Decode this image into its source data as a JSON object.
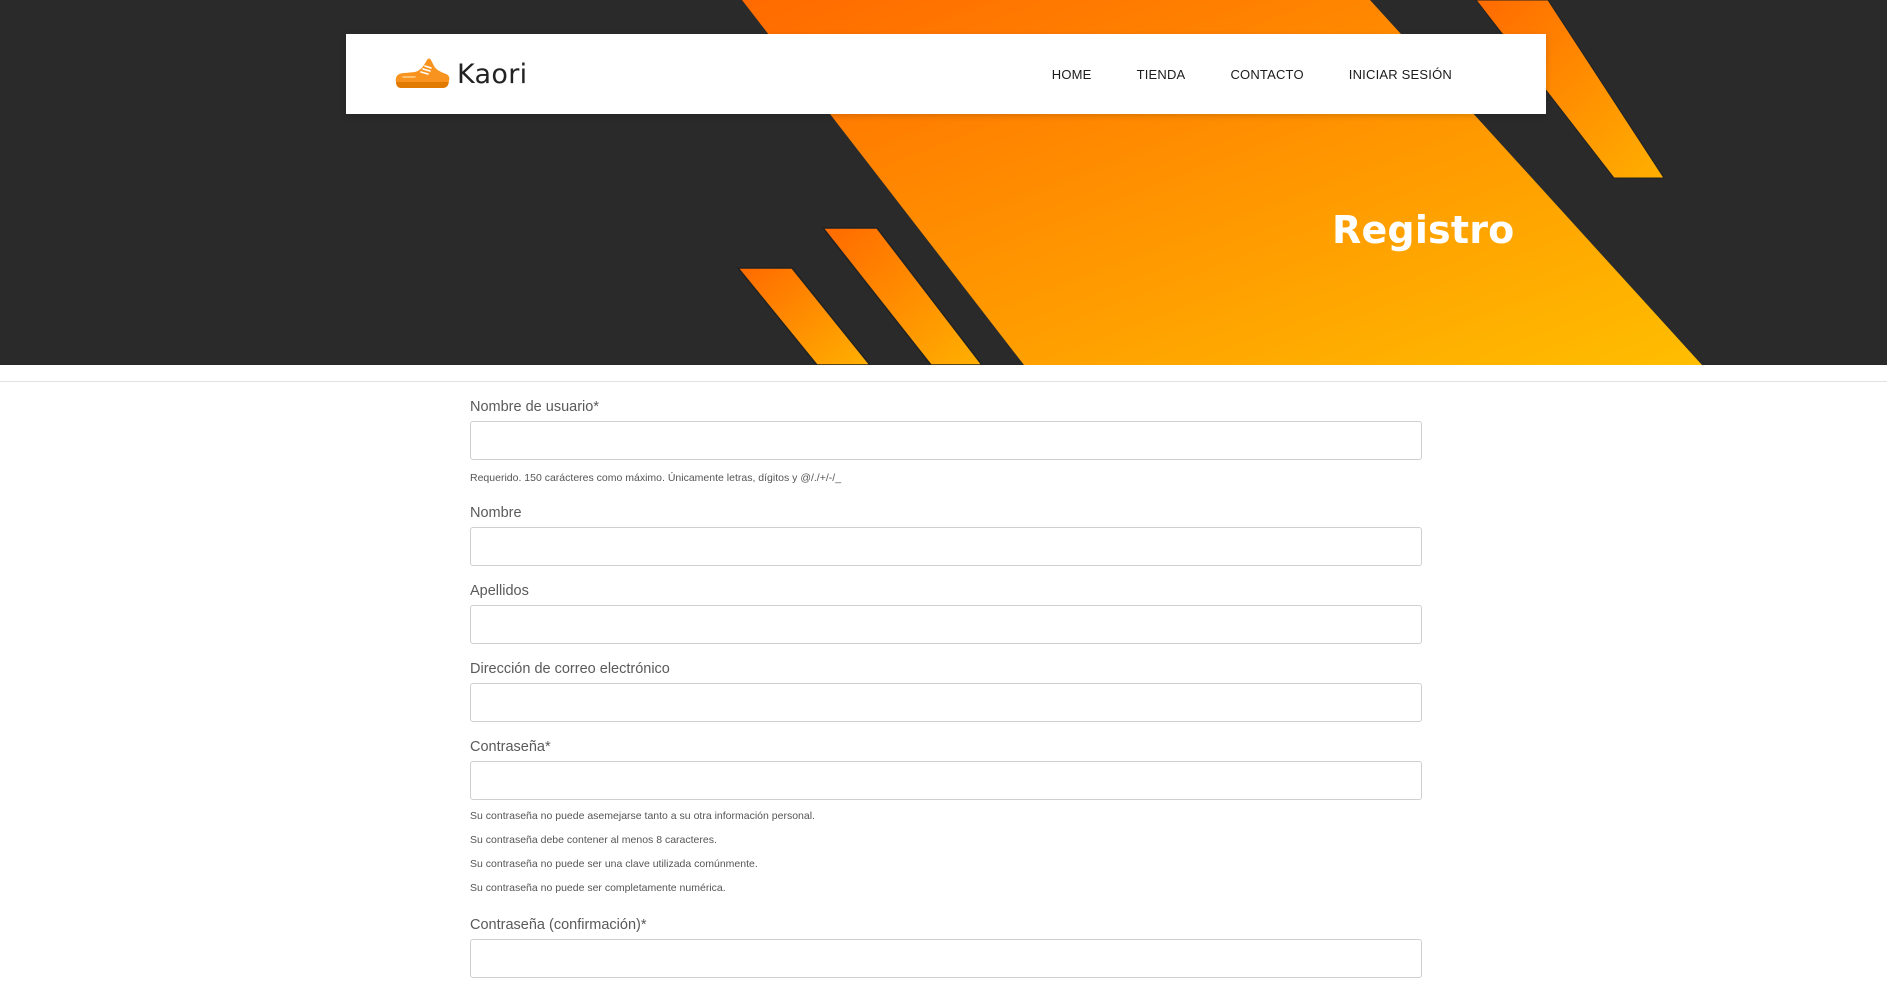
{
  "brand": {
    "name": "Kaori",
    "logo_icon": "sneaker-icon",
    "accent_color": "#f7931e"
  },
  "nav": {
    "items": [
      {
        "label": "HOME"
      },
      {
        "label": "TIENDA"
      },
      {
        "label": "CONTACTO"
      },
      {
        "label": "INICIAR SESIÓN"
      }
    ]
  },
  "hero": {
    "title": "Registro",
    "background_color": "#2a2a2a",
    "gradient_start": "#ff6a00",
    "gradient_end": "#ffb800"
  },
  "form": {
    "username": {
      "label": "Nombre de usuario*",
      "value": "",
      "help": "Requerido. 150 carácteres como máximo. Únicamente letras, dígitos y @/./+/-/_"
    },
    "first_name": {
      "label": "Nombre",
      "value": ""
    },
    "last_name": {
      "label": "Apellidos",
      "value": ""
    },
    "email": {
      "label": "Dirección de correo electrónico",
      "value": ""
    },
    "password": {
      "label": "Contraseña*",
      "value": "",
      "help": [
        "Su contraseña no puede asemejarse tanto a su otra información personal.",
        "Su contraseña debe contener al menos 8 caracteres.",
        "Su contraseña no puede ser una clave utilizada comúnmente.",
        "Su contraseña no puede ser completamente numérica."
      ]
    },
    "password_confirm": {
      "label": "Contraseña (confirmación)*",
      "value": ""
    }
  }
}
